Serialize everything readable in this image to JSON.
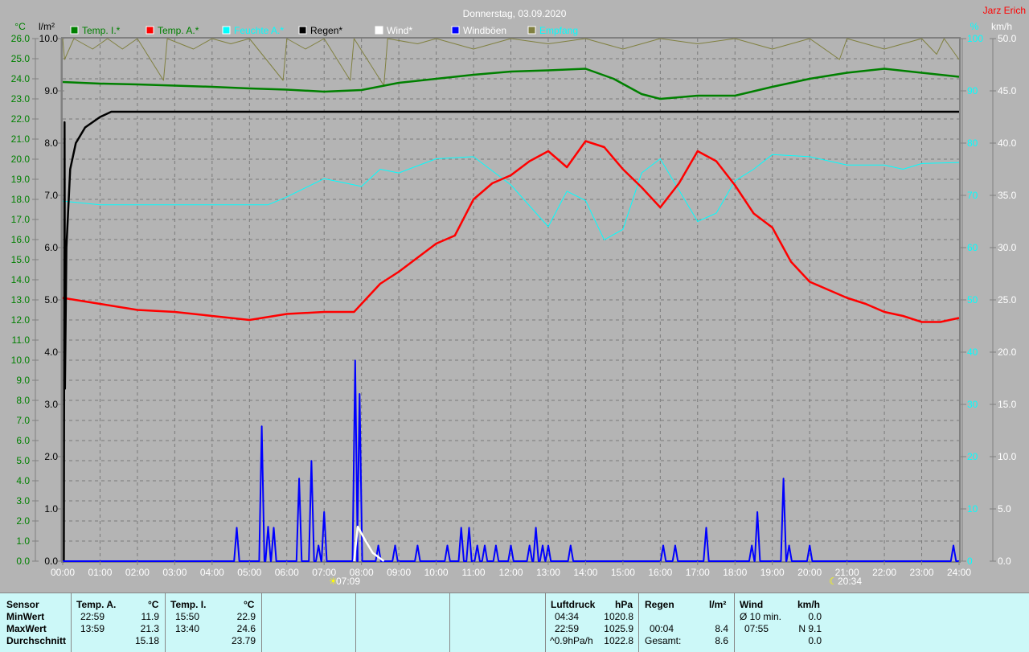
{
  "title": "Donnerstag, 03.09.2020",
  "author": "Jarz Erich",
  "colors": {
    "background": "#b4b4b4",
    "temp_i": "#008000",
    "temp_a": "#ff0000",
    "feuchte": "#00ffff",
    "regen": "#000000",
    "wind": "#ffffff",
    "windboeen": "#0000ff",
    "empfang": "#808040",
    "table_bg": "#ccf8f8"
  },
  "chart_data": {
    "type": "line",
    "title": "Donnerstag, 03.09.2020",
    "x_range_hours": [
      0,
      24
    ],
    "x_ticks": [
      "00:00",
      "01:00",
      "02:00",
      "03:00",
      "04:00",
      "05:00",
      "06:00",
      "07:00",
      "08:00",
      "09:00",
      "10:00",
      "11:00",
      "12:00",
      "13:00",
      "14:00",
      "15:00",
      "16:00",
      "17:00",
      "18:00",
      "19:00",
      "20:00",
      "21:00",
      "22:00",
      "23:00",
      "24:00"
    ],
    "axes": {
      "temp": {
        "unit": "°C",
        "range": [
          0,
          26
        ],
        "ticks": [
          "0.0",
          "1.0",
          "2.0",
          "3.0",
          "4.0",
          "5.0",
          "6.0",
          "7.0",
          "8.0",
          "9.0",
          "10.0",
          "11.0",
          "12.0",
          "13.0",
          "14.0",
          "15.0",
          "16.0",
          "17.0",
          "18.0",
          "19.0",
          "20.0",
          "21.0",
          "22.0",
          "23.0",
          "24.0",
          "25.0",
          "26.0"
        ]
      },
      "rain": {
        "unit": "l/m²",
        "range": [
          0,
          10
        ],
        "ticks": [
          "0.0",
          "1.0",
          "2.0",
          "3.0",
          "4.0",
          "5.0",
          "6.0",
          "7.0",
          "8.0",
          "9.0",
          "10.0"
        ]
      },
      "humidity": {
        "unit": "%",
        "range": [
          0,
          100
        ],
        "ticks": [
          "0",
          "10",
          "20",
          "30",
          "40",
          "50",
          "60",
          "70",
          "80",
          "90",
          "100"
        ]
      },
      "wind": {
        "unit": "km/h",
        "range": [
          0,
          50
        ],
        "ticks": [
          "0.0",
          "5.0",
          "10.0",
          "15.0",
          "20.0",
          "25.0",
          "30.0",
          "35.0",
          "40.0",
          "45.0",
          "50.0"
        ]
      }
    },
    "legend": [
      "Temp. I.*",
      "Temp. A.*",
      "Feuchte A.*",
      "Regen*",
      "Wind*",
      "Windböen",
      "Empfang"
    ],
    "legend_position": "top",
    "grid": true,
    "series": [
      {
        "name": "Temp. I.*",
        "axis": "temp",
        "color": "#008000",
        "points": [
          [
            0,
            23.84
          ],
          [
            1,
            23.76
          ],
          [
            2,
            23.72
          ],
          [
            3,
            23.66
          ],
          [
            4,
            23.6
          ],
          [
            5,
            23.52
          ],
          [
            6,
            23.46
          ],
          [
            7,
            23.36
          ],
          [
            8,
            23.44
          ],
          [
            9,
            23.8
          ],
          [
            10,
            24.0
          ],
          [
            11,
            24.2
          ],
          [
            12,
            24.36
          ],
          [
            13,
            24.42
          ],
          [
            14,
            24.5
          ],
          [
            14.75,
            24.0
          ],
          [
            15.5,
            23.24
          ],
          [
            16,
            23.0
          ],
          [
            17,
            23.16
          ],
          [
            18,
            23.16
          ],
          [
            19,
            23.6
          ],
          [
            20,
            24.0
          ],
          [
            21,
            24.3
          ],
          [
            22,
            24.5
          ],
          [
            23,
            24.3
          ],
          [
            24,
            24.1
          ]
        ]
      },
      {
        "name": "Temp. A.*",
        "axis": "temp",
        "color": "#ff0000",
        "points": [
          [
            0,
            13.1
          ],
          [
            1,
            12.8
          ],
          [
            2,
            12.5
          ],
          [
            3,
            12.4
          ],
          [
            4,
            12.2
          ],
          [
            5,
            12.0
          ],
          [
            6,
            12.3
          ],
          [
            7,
            12.4
          ],
          [
            7.8,
            12.4
          ],
          [
            8.5,
            13.8
          ],
          [
            9,
            14.4
          ],
          [
            10,
            15.8
          ],
          [
            10.5,
            16.2
          ],
          [
            11,
            18.0
          ],
          [
            11.5,
            18.8
          ],
          [
            12,
            19.2
          ],
          [
            12.5,
            19.9
          ],
          [
            13,
            20.4
          ],
          [
            13.5,
            19.6
          ],
          [
            14,
            20.9
          ],
          [
            14.5,
            20.6
          ],
          [
            15,
            19.5
          ],
          [
            15.5,
            18.6
          ],
          [
            16,
            17.6
          ],
          [
            16.5,
            18.8
          ],
          [
            17,
            20.4
          ],
          [
            17.5,
            19.9
          ],
          [
            18,
            18.7
          ],
          [
            18.5,
            17.3
          ],
          [
            19,
            16.6
          ],
          [
            19.5,
            14.9
          ],
          [
            20,
            13.9
          ],
          [
            20.5,
            13.5
          ],
          [
            21,
            13.1
          ],
          [
            21.5,
            12.8
          ],
          [
            22,
            12.4
          ],
          [
            22.5,
            12.2
          ],
          [
            23,
            11.9
          ],
          [
            23.5,
            11.9
          ],
          [
            24,
            12.1
          ]
        ]
      },
      {
        "name": "Feuchte A.*",
        "axis": "humidity",
        "color": "#00ffff",
        "points": [
          [
            0,
            68.9
          ],
          [
            1,
            68.2
          ],
          [
            5.5,
            68.2
          ],
          [
            6,
            69.7
          ],
          [
            7,
            73.2
          ],
          [
            8,
            71.7
          ],
          [
            8.5,
            75
          ],
          [
            9,
            74.3
          ],
          [
            10,
            77
          ],
          [
            11,
            77.4
          ],
          [
            12,
            72
          ],
          [
            12.5,
            68
          ],
          [
            13,
            64
          ],
          [
            13.5,
            70.8
          ],
          [
            14,
            69
          ],
          [
            14.5,
            61.5
          ],
          [
            15,
            63.5
          ],
          [
            15.5,
            74.3
          ],
          [
            16,
            77
          ],
          [
            16.5,
            71
          ],
          [
            17,
            65
          ],
          [
            17.5,
            66.6
          ],
          [
            18,
            72.8
          ],
          [
            18.5,
            75
          ],
          [
            19,
            77.8
          ],
          [
            20,
            77.4
          ],
          [
            21,
            75.8
          ],
          [
            22,
            75.8
          ],
          [
            22.5,
            75
          ],
          [
            23,
            76.1
          ],
          [
            24,
            76.3
          ]
        ]
      },
      {
        "name": "Regen*",
        "axis": "rain",
        "color": "#000000",
        "points": [
          [
            0,
            0
          ],
          [
            0.03,
            0
          ],
          [
            0.05,
            8.4
          ],
          [
            0.06,
            3.3
          ],
          [
            0.1,
            6
          ],
          [
            0.2,
            7.5
          ],
          [
            0.35,
            8.0
          ],
          [
            0.6,
            8.3
          ],
          [
            1,
            8.5
          ],
          [
            1.3,
            8.6
          ],
          [
            24,
            8.6
          ]
        ]
      },
      {
        "name": "Wind*",
        "axis": "wind",
        "color": "#ffffff",
        "points": [
          [
            7.8,
            0
          ],
          [
            7.9,
            3.3
          ],
          [
            8.1,
            2.0
          ],
          [
            8.3,
            0.8
          ],
          [
            8.6,
            0
          ]
        ]
      },
      {
        "name": "Windböen",
        "axis": "wind",
        "color": "#0000ff",
        "peaks": [
          [
            4.66,
            3.2
          ],
          [
            5.33,
            12.9
          ],
          [
            5.5,
            3.3
          ],
          [
            5.65,
            3.2
          ],
          [
            6.33,
            7.9
          ],
          [
            6.66,
            9.6
          ],
          [
            6.85,
            1.5
          ],
          [
            7.0,
            4.7
          ],
          [
            7.83,
            19.2
          ],
          [
            7.95,
            16.0
          ],
          [
            8.45,
            1.5
          ],
          [
            8.9,
            1.5
          ],
          [
            9.5,
            1.5
          ],
          [
            10.3,
            1.5
          ],
          [
            10.67,
            3.2
          ],
          [
            10.88,
            3.2
          ],
          [
            11.1,
            1.5
          ],
          [
            11.3,
            1.5
          ],
          [
            11.6,
            1.5
          ],
          [
            12.0,
            1.5
          ],
          [
            12.5,
            1.5
          ],
          [
            12.67,
            3.2
          ],
          [
            12.85,
            1.5
          ],
          [
            13.0,
            1.5
          ],
          [
            13.6,
            1.5
          ],
          [
            16.08,
            1.5
          ],
          [
            16.4,
            1.5
          ],
          [
            17.23,
            3.2
          ],
          [
            18.45,
            1.5
          ],
          [
            18.6,
            4.7
          ],
          [
            19.3,
            7.9
          ],
          [
            19.45,
            1.5
          ],
          [
            20.0,
            1.5
          ],
          [
            23.85,
            1.5
          ]
        ]
      },
      {
        "name": "Empfang",
        "axis": "humidity",
        "color": "#808040",
        "points": [
          [
            0,
            100
          ],
          [
            0.05,
            96
          ],
          [
            0.3,
            100
          ],
          [
            0.8,
            98
          ],
          [
            1.2,
            100
          ],
          [
            1.6,
            98
          ],
          [
            2,
            100
          ],
          [
            2.7,
            92
          ],
          [
            2.8,
            100
          ],
          [
            3.5,
            98
          ],
          [
            4,
            100
          ],
          [
            4.5,
            99
          ],
          [
            5,
            100
          ],
          [
            5.9,
            92
          ],
          [
            6,
            100
          ],
          [
            6.5,
            98
          ],
          [
            7,
            100
          ],
          [
            7.7,
            92
          ],
          [
            7.8,
            100
          ],
          [
            8.6,
            91
          ],
          [
            8.7,
            100
          ],
          [
            9.5,
            99
          ],
          [
            10,
            100
          ],
          [
            11,
            98
          ],
          [
            12,
            100
          ],
          [
            13,
            99
          ],
          [
            14,
            100
          ],
          [
            15,
            98
          ],
          [
            16,
            100
          ],
          [
            17,
            99
          ],
          [
            18,
            100
          ],
          [
            19,
            98
          ],
          [
            20,
            100
          ],
          [
            20.8,
            96
          ],
          [
            21,
            100
          ],
          [
            22,
            98
          ],
          [
            23,
            100
          ],
          [
            23.4,
            97
          ],
          [
            23.6,
            100
          ],
          [
            24,
            96
          ]
        ]
      }
    ],
    "annotations": {
      "sunrise": "07:09",
      "sunset": "20:34"
    }
  },
  "table": {
    "row_labels": {
      "sensor": "Sensor",
      "min": "MinWert",
      "max": "MaxWert",
      "avg": "Durchschnitt"
    },
    "temp_a": {
      "header": "Temp. A.",
      "unit": "°C",
      "min_time": "22:59",
      "min": "11.9",
      "max_time": "13:59",
      "max": "21.3",
      "avg": "15.18"
    },
    "temp_i": {
      "header": "Temp. I.",
      "unit": "°C",
      "min_time": "15:50",
      "min": "22.9",
      "max_time": "13:40",
      "max": "24.6",
      "avg": "23.79"
    },
    "luftdruck": {
      "header": "Luftdruck",
      "unit": "hPa",
      "min_time": "04:34",
      "min": "1020.8",
      "max_time": "22:59",
      "max": "1025.9",
      "trend": "^0.9hPa/h",
      "avg": "1022.8"
    },
    "regen": {
      "header": "Regen",
      "unit": "l/m²",
      "max_time": "00:04",
      "max": "8.4",
      "total_label": "Gesamt:",
      "total": "8.6"
    },
    "wind": {
      "header": "Wind",
      "unit": "km/h",
      "avg_label": "Ø 10 min.",
      "avg": "0.0",
      "max_time": "07:55",
      "max": "N 9.1",
      "last": "0.0"
    }
  }
}
